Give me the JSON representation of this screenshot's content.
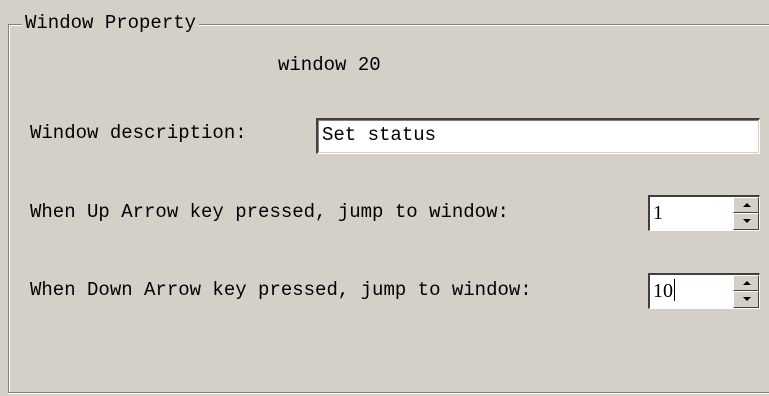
{
  "group": {
    "title": "Window Property"
  },
  "window_name": "window 20",
  "description": {
    "label": "Window description:",
    "value": "Set status"
  },
  "up_arrow": {
    "label": "When Up Arrow key pressed, jump to window:",
    "value": "1"
  },
  "down_arrow": {
    "label": "When Down Arrow key pressed, jump to window:",
    "value": "10"
  },
  "icons": {
    "spin_up": "triangle-up-icon",
    "spin_down": "triangle-down-icon"
  },
  "colors": {
    "panel_background": "#d4d0c8",
    "field_background": "#ffffff"
  }
}
